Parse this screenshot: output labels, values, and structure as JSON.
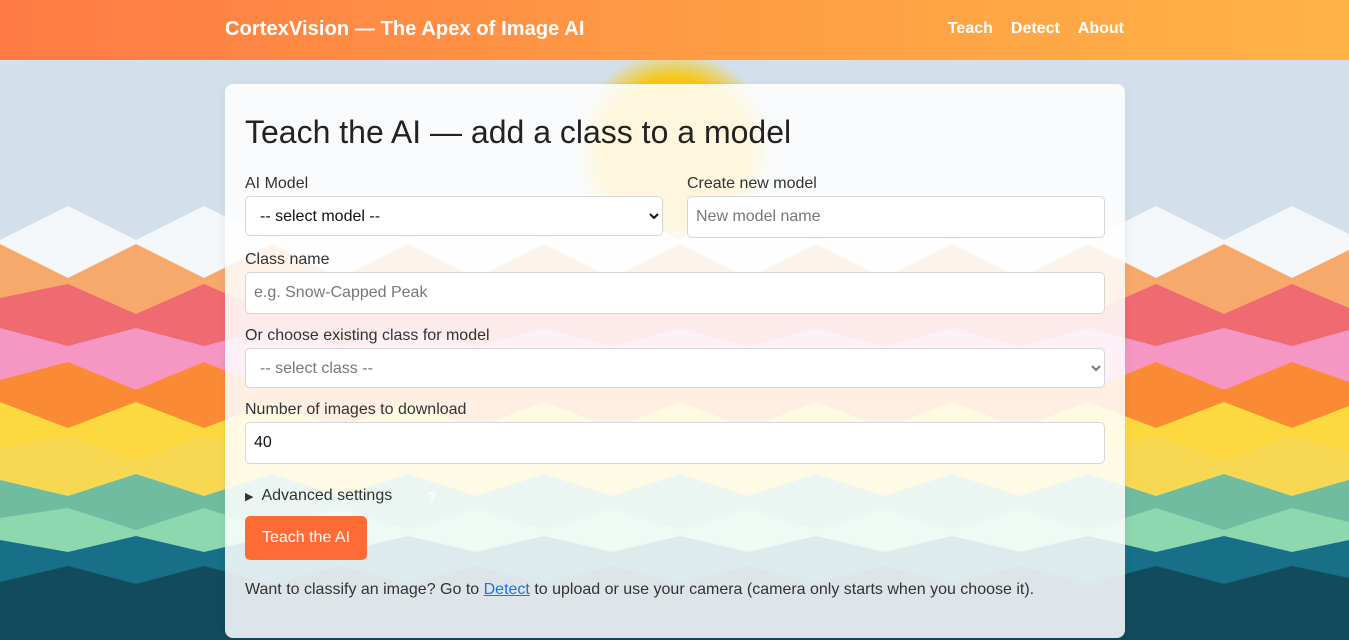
{
  "header": {
    "brand": "CortexVision — The Apex of Image AI",
    "nav": [
      "Teach",
      "Detect",
      "About"
    ]
  },
  "form": {
    "title": "Teach the AI — add a class to a model",
    "model_label": "AI Model",
    "model_select_value": "-- select model --",
    "new_model_label": "Create new model",
    "new_model_placeholder": "New model name",
    "class_label": "Class name",
    "class_placeholder": "e.g. Snow-Capped Peak",
    "existing_class_label": "Or choose existing class for model",
    "existing_class_value": "-- select class --",
    "num_images_label": "Number of images to download",
    "num_images_value": "40",
    "advanced_label": "Advanced settings",
    "help_icon_glyph": "?",
    "submit_label": "Teach the AI"
  },
  "footer": {
    "text_before": "Want to classify an image? Go to ",
    "link_text": "Detect",
    "text_after": " to upload or use your camera (camera only starts when you choose it)."
  },
  "colors": {
    "header_start": "#ff7a45",
    "header_end": "#ffb347",
    "button": "#ff6b35",
    "link": "#1a73e8",
    "sun": "#f6c30f"
  }
}
